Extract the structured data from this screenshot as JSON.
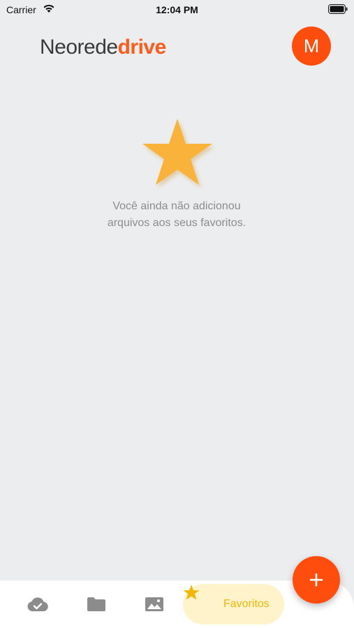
{
  "status_bar": {
    "carrier": "Carrier",
    "time": "12:04 PM"
  },
  "header": {
    "logo_light": "Neorede",
    "logo_bold": "drive",
    "avatar_initial": "M"
  },
  "empty_state": {
    "line1": "Você ainda não adicionou",
    "line2": "arquivos aos seus favoritos."
  },
  "nav": {
    "items": [
      {
        "icon": "cloud-check-icon"
      },
      {
        "icon": "folder-icon"
      },
      {
        "icon": "image-icon"
      },
      {
        "icon": "star-icon",
        "label": "Favoritos",
        "active": true
      }
    ]
  },
  "fab": {
    "icon": "plus-icon"
  },
  "colors": {
    "accent": "#ff4d0d",
    "star": "#f9b33b",
    "active_tab_bg": "#fff3cc",
    "active_tab_text": "#f2b705",
    "background": "#ecedef"
  }
}
